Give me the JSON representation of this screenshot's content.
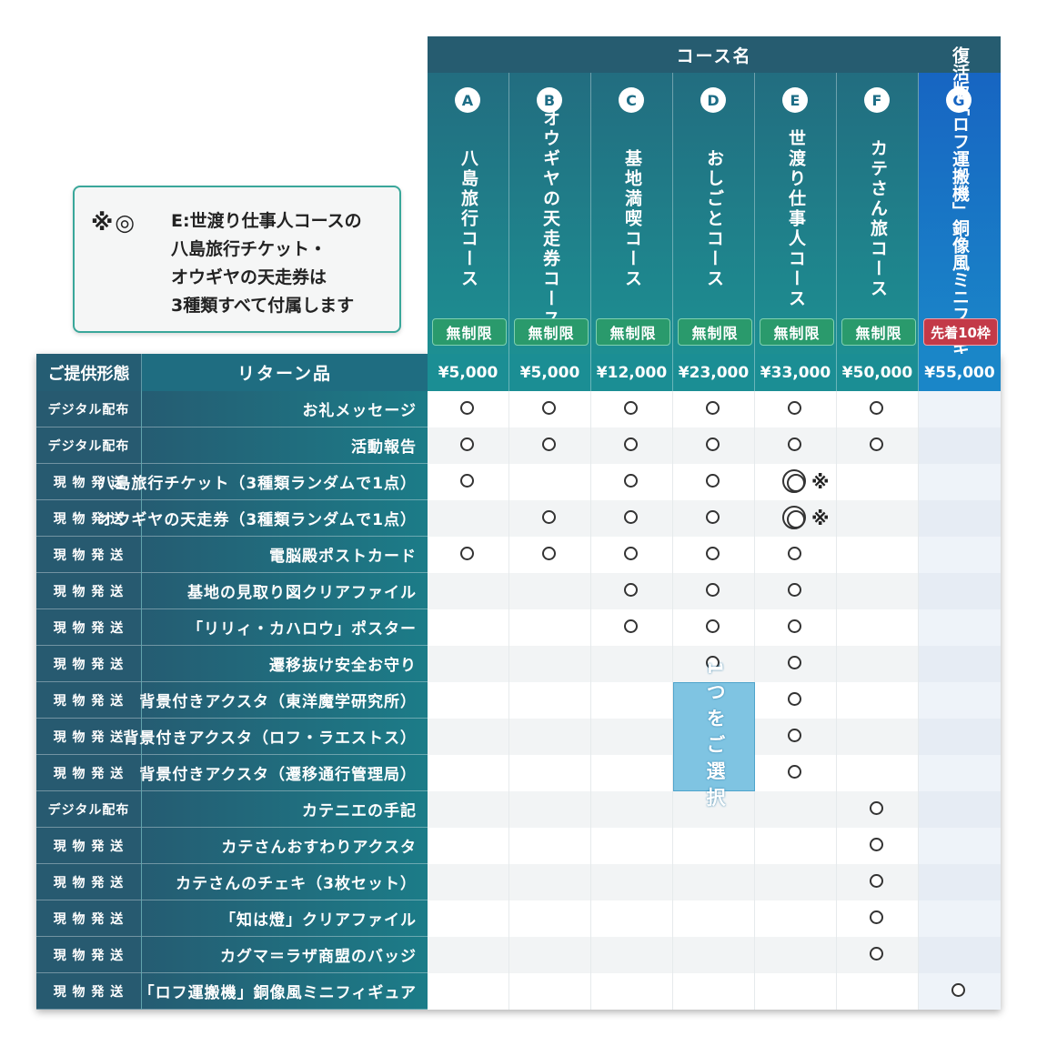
{
  "note": {
    "mark": "※◎",
    "lines": [
      "E:世渡り仕事人コースの",
      "八島旅行チケット・",
      "オウギヤの天走券は",
      "3種類すべて付属します"
    ]
  },
  "header": {
    "courses_label": "コース名",
    "type_label": "ご提供形態",
    "item_label": "リターン品"
  },
  "courses": [
    {
      "letter": "A",
      "name": "八島旅行コース",
      "badge": "無制限",
      "price": "¥5,000"
    },
    {
      "letter": "B",
      "name": "オウギヤの天走券コース",
      "badge": "無制限",
      "price": "¥5,000"
    },
    {
      "letter": "C",
      "name": "基地満喫コース",
      "badge": "無制限",
      "price": "¥12,000"
    },
    {
      "letter": "D",
      "name": "おしごとコース",
      "badge": "無制限",
      "price": "¥23,000"
    },
    {
      "letter": "E",
      "name": "世渡り仕事人コース",
      "badge": "無制限",
      "price": "¥33,000"
    },
    {
      "letter": "F",
      "name": "カテさん旅コース",
      "badge": "無制限",
      "price": "¥50,000"
    },
    {
      "letter": "G",
      "name": "復活版「ロフ運搬機」銅像風ミニフィギュア",
      "badge": "先着10枠",
      "price": "¥55,000"
    }
  ],
  "rows": [
    {
      "type": "デジタル配布",
      "item": "お礼メッセージ",
      "marks": [
        "o",
        "o",
        "o",
        "o",
        "o",
        "o",
        ""
      ]
    },
    {
      "type": "デジタル配布",
      "item": "活動報告",
      "marks": [
        "o",
        "o",
        "o",
        "o",
        "o",
        "o",
        ""
      ]
    },
    {
      "type": "現 物 発 送",
      "item": "八島旅行チケット（3種類ランダムで1点）",
      "marks": [
        "o",
        "",
        "o",
        "o",
        "◎",
        "",
        ""
      ]
    },
    {
      "type": "現 物 発 送",
      "item": "オウギヤの天走券（3種類ランダムで1点）",
      "marks": [
        "",
        "o",
        "o",
        "o",
        "◎",
        "",
        ""
      ]
    },
    {
      "type": "現 物 発 送",
      "item": "電脳殿ポストカード",
      "marks": [
        "o",
        "o",
        "o",
        "o",
        "o",
        "",
        ""
      ]
    },
    {
      "type": "現 物 発 送",
      "item": "基地の見取り図クリアファイル",
      "marks": [
        "",
        "",
        "o",
        "o",
        "o",
        "",
        ""
      ]
    },
    {
      "type": "現 物 発 送",
      "item": "「リリィ・カハロウ」ポスター",
      "marks": [
        "",
        "",
        "o",
        "o",
        "o",
        "",
        ""
      ]
    },
    {
      "type": "現 物 発 送",
      "item": "遷移抜け安全お守り",
      "marks": [
        "",
        "",
        "",
        "o",
        "o",
        "",
        ""
      ]
    },
    {
      "type": "現 物 発 送",
      "item": "背景付きアクスタ（東洋魔学研究所）",
      "marks": [
        "",
        "",
        "",
        "",
        "o",
        "",
        ""
      ]
    },
    {
      "type": "現 物 発 送",
      "item": "背景付きアクスタ（ロフ・ラエストス）",
      "marks": [
        "",
        "",
        "",
        "",
        "o",
        "",
        ""
      ]
    },
    {
      "type": "現 物 発 送",
      "item": "背景付きアクスタ（遷移通行管理局）",
      "marks": [
        "",
        "",
        "",
        "",
        "o",
        "",
        ""
      ]
    },
    {
      "type": "デジタル配布",
      "item": "カテニエの手記",
      "marks": [
        "",
        "",
        "",
        "",
        "",
        "o",
        ""
      ]
    },
    {
      "type": "現 物 発 送",
      "item": "カテさんおすわりアクスタ",
      "marks": [
        "",
        "",
        "",
        "",
        "",
        "o",
        ""
      ]
    },
    {
      "type": "現 物 発 送",
      "item": "カテさんのチェキ（3枚セット）",
      "marks": [
        "",
        "",
        "",
        "",
        "",
        "o",
        ""
      ]
    },
    {
      "type": "現 物 発 送",
      "item": "「知は燈」クリアファイル",
      "marks": [
        "",
        "",
        "",
        "",
        "",
        "o",
        ""
      ]
    },
    {
      "type": "現 物 発 送",
      "item": "カグマ＝ラザ商盟のバッジ",
      "marks": [
        "",
        "",
        "",
        "",
        "",
        "o",
        ""
      ]
    },
    {
      "type": "現 物 発 送",
      "item": "「ロフ運搬機」銅像風ミニフィギュア",
      "marks": [
        "",
        "",
        "",
        "",
        "",
        "",
        "o"
      ]
    }
  ],
  "choose_one": "1つをご選択",
  "asterisk": "※"
}
